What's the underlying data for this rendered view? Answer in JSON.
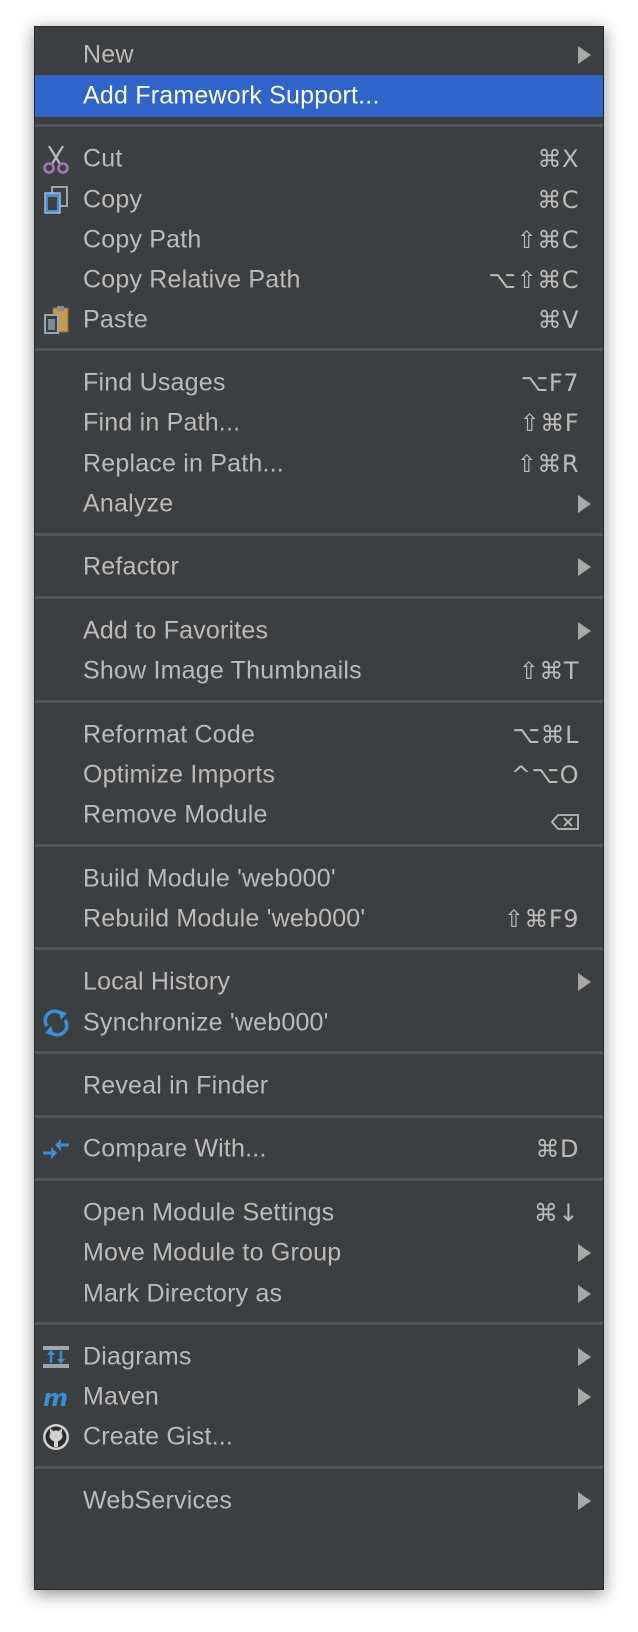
{
  "menu": {
    "items": [
      {
        "label": "New",
        "submenu": true
      },
      {
        "label": "Add Framework Support...",
        "highlighted": true
      },
      {
        "label": "Cut",
        "shortcut": "⌘X",
        "icon": "scissors-icon"
      },
      {
        "label": "Copy",
        "shortcut": "⌘C",
        "icon": "copy-icon"
      },
      {
        "label": "Copy Path",
        "shortcut": "⇧⌘C"
      },
      {
        "label": "Copy Relative Path",
        "shortcut": "⌥⇧⌘C"
      },
      {
        "label": "Paste",
        "shortcut": "⌘V",
        "icon": "paste-icon"
      },
      {
        "label": "Find Usages",
        "shortcut": "⌥F7"
      },
      {
        "label": "Find in Path...",
        "shortcut": "⇧⌘F"
      },
      {
        "label": "Replace in Path...",
        "shortcut": "⇧⌘R"
      },
      {
        "label": "Analyze",
        "submenu": true
      },
      {
        "label": "Refactor",
        "submenu": true
      },
      {
        "label": "Add to Favorites",
        "submenu": true
      },
      {
        "label": "Show Image Thumbnails",
        "shortcut": "⇧⌘T"
      },
      {
        "label": "Reformat Code",
        "shortcut": "⌥⌘L"
      },
      {
        "label": "Optimize Imports",
        "shortcut": "^⌥O"
      },
      {
        "label": "Remove Module",
        "shortcut_icon": "delete-key-icon"
      },
      {
        "label": "Build Module 'web000'"
      },
      {
        "label": "Rebuild Module 'web000'",
        "shortcut": "⇧⌘F9"
      },
      {
        "label": "Local History",
        "submenu": true
      },
      {
        "label": "Synchronize 'web000'",
        "icon": "sync-icon"
      },
      {
        "label": "Reveal in Finder"
      },
      {
        "label": "Compare With...",
        "shortcut": "⌘D",
        "icon": "compare-icon"
      },
      {
        "label": "Open Module Settings",
        "shortcut": "⌘↓"
      },
      {
        "label": "Move Module to Group",
        "submenu": true
      },
      {
        "label": "Mark Directory as",
        "submenu": true
      },
      {
        "label": "Diagrams",
        "submenu": true,
        "icon": "diagram-icon"
      },
      {
        "label": "Maven",
        "submenu": true,
        "icon": "maven-icon"
      },
      {
        "label": "Create Gist...",
        "icon": "github-icon"
      },
      {
        "label": "WebServices",
        "submenu": true
      }
    ]
  },
  "colors": {
    "menu_background": "#3c3f41",
    "highlight": "#2f65ca",
    "text": "#bbbbbb",
    "separator": "#515658"
  }
}
